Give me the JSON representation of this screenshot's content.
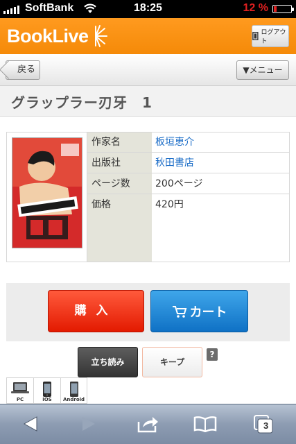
{
  "status_bar": {
    "carrier": "SoftBank",
    "time": "18:25",
    "battery": "12 %",
    "battery_color": "#e02020"
  },
  "header": {
    "logo_text": "BookLive",
    "logout_label": "ログアウト",
    "brand_color": "#f7900f"
  },
  "nav": {
    "back_label": "戻る",
    "menu_label": "▼メニュー"
  },
  "product": {
    "title": "グラップラー刃牙　1",
    "cover_icon": "manga-cover-image",
    "details": [
      {
        "label": "作家名",
        "value": "板垣恵介",
        "link": true
      },
      {
        "label": "出版社",
        "value": "秋田書店",
        "link": true
      },
      {
        "label": "ページ数",
        "value": "200ページ",
        "link": false
      },
      {
        "label": "価格",
        "value": "420円",
        "link": false
      }
    ]
  },
  "actions": {
    "buy_label": "購入",
    "cart_label": "カート",
    "preview_label": "立ち読み",
    "keep_label": "キープ",
    "help_label": "?",
    "buy_color": "#e31a00",
    "cart_color": "#1580d0"
  },
  "devices": [
    {
      "label": "PC",
      "icon": "laptop-icon"
    },
    {
      "label": "iOS",
      "icon": "iphone-icon"
    },
    {
      "label": "Android",
      "icon": "android-phone-icon"
    }
  ],
  "toolbar": {
    "tabs_count": "3",
    "items": [
      "back-arrow-icon",
      "forward-arrow-icon",
      "share-icon",
      "bookmarks-icon",
      "tabs-icon"
    ]
  }
}
